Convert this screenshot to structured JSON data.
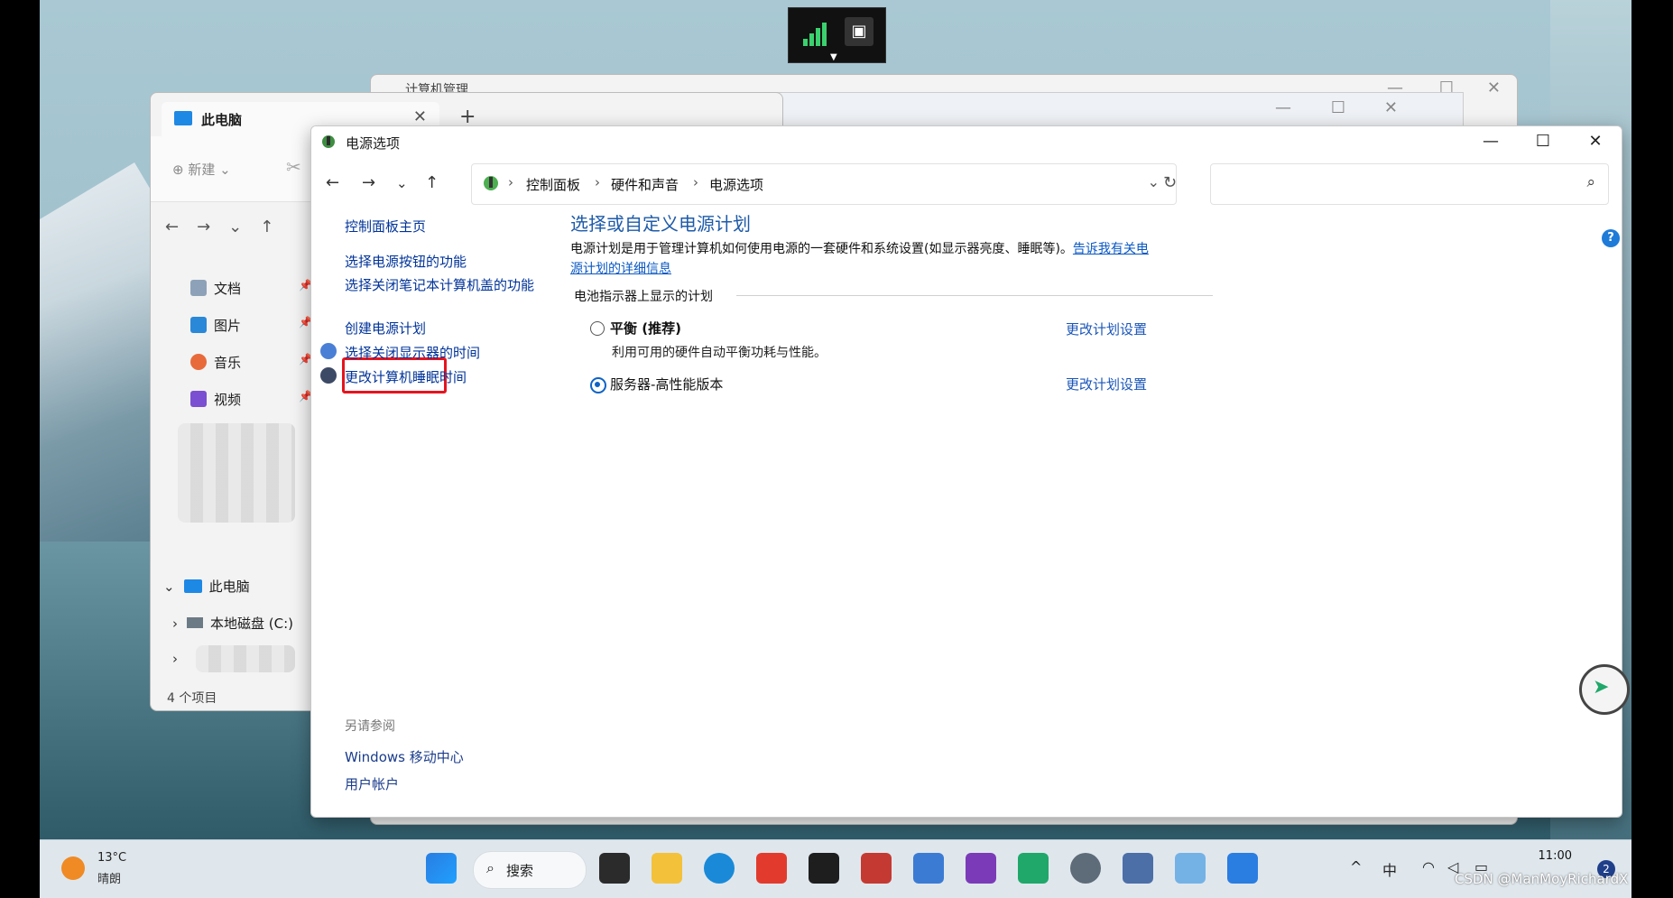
{
  "power_window": {
    "title": "电源选项",
    "breadcrumb": [
      "控制面板",
      "硬件和声音",
      "电源选项"
    ],
    "search_placeholder": "",
    "left_nav": {
      "home": "控制面板主页",
      "items": [
        "选择电源按钮的功能",
        "选择关闭笔记本计算机盖的功能",
        "创建电源计划",
        "选择关闭显示器的时间",
        "更改计算机睡眠时间"
      ]
    },
    "see_also": {
      "heading": "另请参阅",
      "links": [
        "Windows 移动中心",
        "用户帐户"
      ]
    },
    "main": {
      "heading": "选择或自定义电源计划",
      "description": "电源计划是用于管理计算机如何使用电源的一套硬件和系统设置(如显示器亮度、睡眠等)。",
      "more_link": "告诉我有关电源计划的详细信息",
      "group_label": "电池指示器上显示的计划",
      "plans": [
        {
          "name": "平衡 (推荐)",
          "desc": "利用可用的硬件自动平衡功耗与性能。",
          "link": "更改计划设置",
          "selected": false
        },
        {
          "name": "服务器-高性能版本",
          "desc": "",
          "link": "更改计划设置",
          "selected": true
        }
      ]
    }
  },
  "explorer_window": {
    "tab_title": "此电脑",
    "new_button": "新建",
    "quick_access": [
      "文档",
      "图片",
      "音乐",
      "视频"
    ],
    "tree": {
      "this_pc": "此电脑",
      "local_disk": "本地磁盘 (C:)"
    },
    "status": "4 个项目"
  },
  "mgmt_window": {
    "title": "计算机管理"
  },
  "taskbar": {
    "weather_temp": "13°C",
    "weather_state": "晴朗",
    "search_label": "搜索",
    "ime": "中",
    "time": "11:00",
    "notification_count": "2"
  },
  "watermark": "CSDN @ManMoyRichardX",
  "colors": {
    "accent": "#1e5ba8",
    "link": "#003399",
    "highlight_box": "#e6141e"
  }
}
